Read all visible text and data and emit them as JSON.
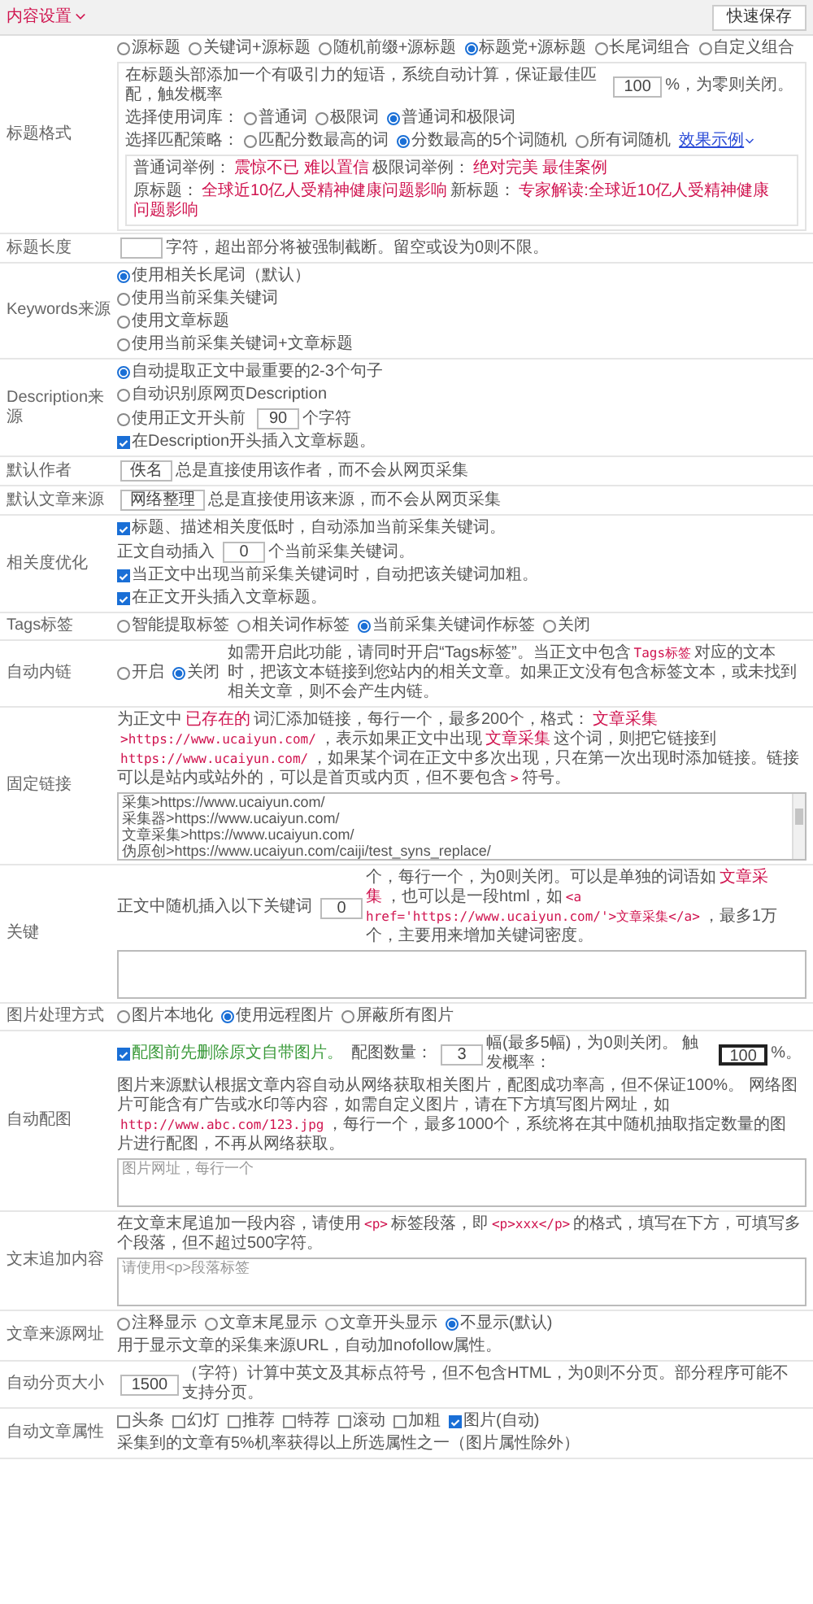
{
  "header": {
    "title": "内容设置",
    "save_button": "快速保存"
  },
  "rows": [
    {
      "label": "标题格式",
      "lines": [
        {
          "kind": "line",
          "parts": [
            {
              "kind": "radio",
              "label": "源标题",
              "selected": false
            },
            {
              "kind": "radio",
              "label": "关键词+源标题",
              "selected": false
            },
            {
              "kind": "radio",
              "label": "随机前缀+源标题",
              "selected": false
            },
            {
              "kind": "radio",
              "label": "标题党+源标题",
              "selected": true
            },
            {
              "kind": "radio",
              "label": "长尾词组合",
              "selected": false
            },
            {
              "kind": "radio",
              "label": "自定义组合",
              "selected": false
            }
          ]
        },
        {
          "kind": "panel",
          "lines": [
            {
              "kind": "line",
              "parts": [
                {
                  "kind": "text",
                  "text": "在标题头部添加一个有吸引力的短语，系统自动计算，保证最佳匹配，触发概率"
                },
                {
                  "kind": "input",
                  "value": "100"
                },
                {
                  "kind": "text",
                  "text": "%，为零则关闭。"
                }
              ]
            },
            {
              "kind": "line",
              "parts": [
                {
                  "kind": "text",
                  "text": "选择使用词库："
                },
                {
                  "kind": "radio",
                  "label": "普通词",
                  "selected": false
                },
                {
                  "kind": "radio",
                  "label": "极限词",
                  "selected": false
                },
                {
                  "kind": "radio",
                  "label": "普通词和极限词",
                  "selected": true
                }
              ]
            },
            {
              "kind": "line",
              "parts": [
                {
                  "kind": "text",
                  "text": "选择匹配策略："
                },
                {
                  "kind": "radio",
                  "label": "匹配分数最高的词",
                  "selected": false
                },
                {
                  "kind": "radio",
                  "label": "分数最高的5个词随机",
                  "selected": true
                },
                {
                  "kind": "radio",
                  "label": "所有词随机",
                  "selected": false
                },
                {
                  "kind": "link",
                  "text": "效果示例"
                }
              ]
            },
            {
              "kind": "box",
              "lines": [
                {
                  "kind": "line",
                  "parts": [
                    {
                      "kind": "text",
                      "text": "普通词举例："
                    },
                    {
                      "kind": "red",
                      "text": "震惊不已 难以置信"
                    },
                    {
                      "kind": "text",
                      "text": "极限词举例："
                    },
                    {
                      "kind": "red",
                      "text": "绝对完美 最佳案例"
                    }
                  ]
                },
                {
                  "kind": "line",
                  "parts": [
                    {
                      "kind": "text",
                      "text": "原标题："
                    },
                    {
                      "kind": "red",
                      "text": "全球近10亿人受精神健康问题影响"
                    },
                    {
                      "kind": "text",
                      "text": "新标题："
                    },
                    {
                      "kind": "red",
                      "text": "专家解读:全球近10亿人受精神健康问题影响"
                    }
                  ]
                }
              ]
            }
          ]
        }
      ]
    },
    {
      "label": "标题长度",
      "lines": [
        {
          "kind": "line",
          "parts": [
            {
              "kind": "input"
            },
            {
              "kind": "text",
              "text": "字符，超出部分将被强制截断。留空或设为0则不限。"
            }
          ]
        }
      ]
    },
    {
      "label": "Keywords来源",
      "lines": [
        {
          "kind": "line",
          "parts": [
            {
              "kind": "radio",
              "label": "使用相关长尾词（默认）",
              "selected": true
            }
          ]
        },
        {
          "kind": "line",
          "parts": [
            {
              "kind": "radio",
              "label": "使用当前采集关键词",
              "selected": false
            }
          ]
        },
        {
          "kind": "line",
          "parts": [
            {
              "kind": "radio",
              "label": "使用文章标题",
              "selected": false
            }
          ]
        },
        {
          "kind": "line",
          "parts": [
            {
              "kind": "radio",
              "label": "使用当前采集关键词+文章标题",
              "selected": false
            }
          ]
        }
      ]
    },
    {
      "label": "Description来源",
      "lines": [
        {
          "kind": "line",
          "parts": [
            {
              "kind": "radio",
              "label": "自动提取正文中最重要的2-3个句子",
              "selected": true
            }
          ]
        },
        {
          "kind": "line",
          "parts": [
            {
              "kind": "radio",
              "label": "自动识别原网页Description",
              "selected": false
            }
          ]
        },
        {
          "kind": "line",
          "parts": [
            {
              "kind": "radio",
              "label": "使用正文开头前",
              "selected": false
            },
            {
              "kind": "input",
              "value": "90"
            },
            {
              "kind": "text",
              "text": "个字符"
            }
          ]
        },
        {
          "kind": "line",
          "parts": [
            {
              "kind": "check",
              "label": "在Description开头插入文章标题。",
              "checked": true
            }
          ]
        }
      ]
    },
    {
      "label": "默认作者",
      "lines": [
        {
          "kind": "line",
          "parts": [
            {
              "kind": "input",
              "value": "佚名"
            },
            {
              "kind": "text",
              "text": "总是直接使用该作者，而不会从网页采集"
            }
          ]
        }
      ]
    },
    {
      "label": "默认文章来源",
      "lines": [
        {
          "kind": "line",
          "parts": [
            {
              "kind": "input",
              "value": "网络整理"
            },
            {
              "kind": "text",
              "text": "总是直接使用该来源，而不会从网页采集"
            }
          ]
        }
      ]
    },
    {
      "label": "相关度优化",
      "lines": [
        {
          "kind": "line",
          "parts": [
            {
              "kind": "check",
              "label": "标题、描述相关度低时，自动添加当前采集关键词。",
              "checked": true
            }
          ]
        },
        {
          "kind": "line",
          "parts": [
            {
              "kind": "text",
              "text": "正文自动插入"
            },
            {
              "kind": "input",
              "value": "0"
            },
            {
              "kind": "text",
              "text": "个当前采集关键词。"
            }
          ]
        },
        {
          "kind": "line",
          "parts": [
            {
              "kind": "check",
              "label": "当正文中出现当前采集关键词时，自动把该关键词加粗。",
              "checked": true
            }
          ]
        },
        {
          "kind": "line",
          "parts": [
            {
              "kind": "check",
              "label": "在正文开头插入文章标题。",
              "checked": true
            }
          ]
        }
      ]
    },
    {
      "label": "Tags标签",
      "lines": [
        {
          "kind": "line",
          "parts": [
            {
              "kind": "radio",
              "label": "智能提取标签",
              "selected": false
            },
            {
              "kind": "radio",
              "label": "相关词作标签",
              "selected": false
            },
            {
              "kind": "radio",
              "label": "当前采集关键词作标签",
              "selected": true
            },
            {
              "kind": "radio",
              "label": "关闭",
              "selected": false
            }
          ]
        }
      ]
    },
    {
      "label": "自动内链",
      "lines": [
        {
          "kind": "line",
          "parts": [
            {
              "kind": "radio",
              "label": "开启",
              "selected": false
            },
            {
              "kind": "radio",
              "label": "关闭",
              "selected": true
            },
            {
              "kind": "text",
              "text": "如需开启此功能，请同时开启“Tags标签”。当正文中包含"
            },
            {
              "kind": "code",
              "text": "Tags标签"
            },
            {
              "kind": "text",
              "text": "对应的文本时，把该文本链接到您站内的相关文章。如果正文没有包含标签文本，或未找到相关文章，则不会产生内链。"
            }
          ]
        }
      ]
    },
    {
      "label": "固定链接",
      "lines": [
        {
          "kind": "line",
          "parts": [
            {
              "kind": "text",
              "text": "为正文中"
            },
            {
              "kind": "red",
              "text": "已存在的"
            },
            {
              "kind": "text",
              "text": "词汇添加链接，每行一个，最多200个，格式："
            },
            {
              "kind": "red",
              "text": "文章采集"
            },
            {
              "kind": "code",
              "text": ">https://www.ucaiyun.com/"
            },
            {
              "kind": "text",
              "text": "，表示如果正文中出现"
            },
            {
              "kind": "red",
              "text": "文章采集"
            },
            {
              "kind": "text",
              "text": "这个词，则把它链接到"
            },
            {
              "kind": "code",
              "text": "https://www.ucaiyun.com/"
            },
            {
              "kind": "text",
              "text": "，如果某个词在正文中多次出现，只在第一次出现时添加链接。链接可以是站内或站外的，可以是首页或内页，但不要包含"
            },
            {
              "kind": "code",
              "text": ">"
            },
            {
              "kind": "text",
              "text": "符号。"
            }
          ]
        },
        {
          "kind": "textarea",
          "lines": [
            "采集>https://www.ucaiyun.com/",
            "采集器>https://www.ucaiyun.com/",
            "文章采集>https://www.ucaiyun.com/",
            "伪原创>https://www.ucaiyun.com/caiji/test_syns_replace/"
          ]
        }
      ]
    },
    {
      "label": "关键",
      "lines": [
        {
          "kind": "line",
          "parts": [
            {
              "kind": "text",
              "text": "正文中随机插入以下关键词"
            },
            {
              "kind": "input",
              "value": "0"
            },
            {
              "kind": "text",
              "text": "个，每行一个，为0则关闭。可以是单独的词语如"
            },
            {
              "kind": "red",
              "text": "文章采集"
            },
            {
              "kind": "text",
              "text": "，也可以是一段html，如"
            },
            {
              "kind": "code",
              "text": "<a href='https://www.ucaiyun.com/'>文章采集</a>"
            },
            {
              "kind": "text",
              "text": "，最多1万个，主要用来增加关键词密度。"
            }
          ]
        },
        {
          "kind": "textarea"
        }
      ]
    },
    {
      "label": "图片处理方式",
      "lines": [
        {
          "kind": "line",
          "parts": [
            {
              "kind": "radio",
              "label": "图片本地化",
              "selected": false
            },
            {
              "kind": "radio",
              "label": "使用远程图片",
              "selected": true
            },
            {
              "kind": "radio",
              "label": "屏蔽所有图片",
              "selected": false
            }
          ]
        }
      ]
    },
    {
      "label": "自动配图",
      "lines": [
        {
          "kind": "line",
          "parts": [
            {
              "kind": "check",
              "label": "配图前先删除原文自带图片。",
              "checked": true,
              "color": "#3a9a3a"
            },
            {
              "kind": "text",
              "text": "配图数量："
            },
            {
              "kind": "input",
              "value": "3"
            },
            {
              "kind": "text",
              "text": "幅(最多5幅)，为0则关闭。 触发概率："
            },
            {
              "kind": "input",
              "value": "100",
              "focused": true
            },
            {
              "kind": "text",
              "text": "%。"
            }
          ]
        },
        {
          "kind": "line",
          "parts": [
            {
              "kind": "text",
              "text": "图片来源默认根据文章内容自动从网络获取相关图片，配图成功率高，但不保证100%。 网络图片可能含有广告或水印等内容，如需自定义图片，请在下方填写图片网址，如"
            },
            {
              "kind": "code",
              "text": "http://www.abc.com/123.jpg"
            },
            {
              "kind": "text",
              "text": "，每行一个，最多1000个，系统将在其中随机抽取指定数量的图片进行配图，不再从网络获取。"
            }
          ]
        },
        {
          "kind": "textarea",
          "placeholder": "图片网址，每行一个"
        }
      ]
    },
    {
      "label": "文末追加内容",
      "lines": [
        {
          "kind": "line",
          "parts": [
            {
              "kind": "text",
              "text": "在文章末尾追加一段内容，请使用"
            },
            {
              "kind": "code",
              "text": "<p>"
            },
            {
              "kind": "text",
              "text": "标签段落，即"
            },
            {
              "kind": "code",
              "text": "<p>xxx</p>"
            },
            {
              "kind": "text",
              "text": "的格式，填写在下方，可填写多个段落，但不超过500字符。"
            }
          ]
        },
        {
          "kind": "textarea",
          "placeholder": "请使用<p>段落标签"
        }
      ]
    },
    {
      "label": "文章来源网址",
      "lines": [
        {
          "kind": "line",
          "parts": [
            {
              "kind": "radio",
              "label": "注释显示",
              "selected": false
            },
            {
              "kind": "radio",
              "label": "文章末尾显示",
              "selected": false
            },
            {
              "kind": "radio",
              "label": "文章开头显示",
              "selected": false
            },
            {
              "kind": "radio",
              "label": "不显示(默认)",
              "selected": true
            }
          ]
        },
        {
          "kind": "line",
          "parts": [
            {
              "kind": "text",
              "text": "用于显示文章的采集来源URL，自动加nofollow属性。"
            }
          ]
        }
      ]
    },
    {
      "label": "自动分页大小",
      "lines": [
        {
          "kind": "line",
          "parts": [
            {
              "kind": "input",
              "value": "1500"
            },
            {
              "kind": "text",
              "text": "（字符）计算中英文及其标点符号，但不包含HTML，为0则不分页。部分程序可能不支持分页。"
            }
          ]
        }
      ]
    },
    {
      "label": "自动文章属性",
      "lines": [
        {
          "kind": "line",
          "parts": [
            {
              "kind": "check",
              "label": "头条",
              "checked": false
            },
            {
              "kind": "check",
              "label": "幻灯",
              "checked": false
            },
            {
              "kind": "check",
              "label": "推荐",
              "checked": false
            },
            {
              "kind": "check",
              "label": "特荐",
              "checked": false
            },
            {
              "kind": "check",
              "label": "滚动",
              "checked": false
            },
            {
              "kind": "check",
              "label": "加粗",
              "checked": false
            },
            {
              "kind": "check",
              "label": "图片(自动)",
              "checked": true
            }
          ]
        },
        {
          "kind": "line",
          "parts": [
            {
              "kind": "text",
              "text": "采集到的文章有5%机率获得以上所选属性之一（图片属性除外）"
            }
          ]
        }
      ]
    }
  ]
}
